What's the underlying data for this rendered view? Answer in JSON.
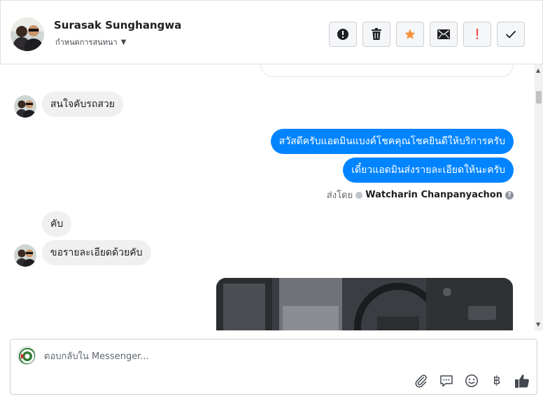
{
  "contact": {
    "name": "Surasak Sunghangwa",
    "assign_label": "กำหนดการสนทนา"
  },
  "header_actions": [
    {
      "name": "mark-spam",
      "icon": "exclamation-circle-icon"
    },
    {
      "name": "delete",
      "icon": "trash-icon"
    },
    {
      "name": "star",
      "icon": "star-icon",
      "color": "#f7923b"
    },
    {
      "name": "mark-unread",
      "icon": "envelope-icon"
    },
    {
      "name": "follow-up",
      "icon": "exclamation-icon",
      "color": "#fa3e3e"
    },
    {
      "name": "mark-done",
      "icon": "check-icon"
    }
  ],
  "messages": [
    {
      "from": "contact",
      "text": "สนใจคับรถสวย"
    },
    {
      "from": "page",
      "text": "สวัสดีครับแอดมินแบงค์โชคคุณโชคยินดีให้บริการครับ"
    },
    {
      "from": "page",
      "text": "เดี๋ยวแอดมินส่งรายละเอียดให้นะครับ"
    },
    {
      "from": "contact",
      "text": "คับ"
    },
    {
      "from": "contact",
      "text": "ขอรายละเอียดด้วยคับ"
    }
  ],
  "sent_by": {
    "prefix": "ส่งโดย",
    "agent": "Watcharin Chanpanyachon"
  },
  "composer": {
    "placeholder": "ตอบกลับใน Messenger...",
    "tools": [
      "paperclip-icon",
      "saved-reply-icon",
      "emoji-icon",
      "baht-icon",
      "thumbs-up-icon"
    ],
    "baht_symbol": "฿"
  },
  "colors": {
    "outgoing_bubble": "#0084ff",
    "incoming_bubble": "#f0f0f0",
    "star": "#f7923b",
    "follow_up": "#fa3e3e"
  }
}
